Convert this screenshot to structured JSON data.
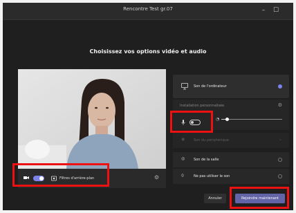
{
  "window": {
    "title": "Rencontre Test gr.07"
  },
  "dialog": {
    "heading": "Choisissez vos options vidéo et audio"
  },
  "video": {
    "background_filter_label": "Filtres d'arrière-plan"
  },
  "audio": {
    "computer_audio_label": "Son de l'ordinateur",
    "custom_setup_label": "Installation personnalisée",
    "speaker_label": "Son du périphérique",
    "room_audio_label": "Son de la salle",
    "no_audio_label": "Ne pas utiliser le son",
    "volume_percent": 8
  },
  "actions": {
    "cancel_label": "Annuler",
    "join_label": "Rejoindre maintenant"
  },
  "colors": {
    "accent": "#6264a7",
    "highlight": "#e11111"
  }
}
